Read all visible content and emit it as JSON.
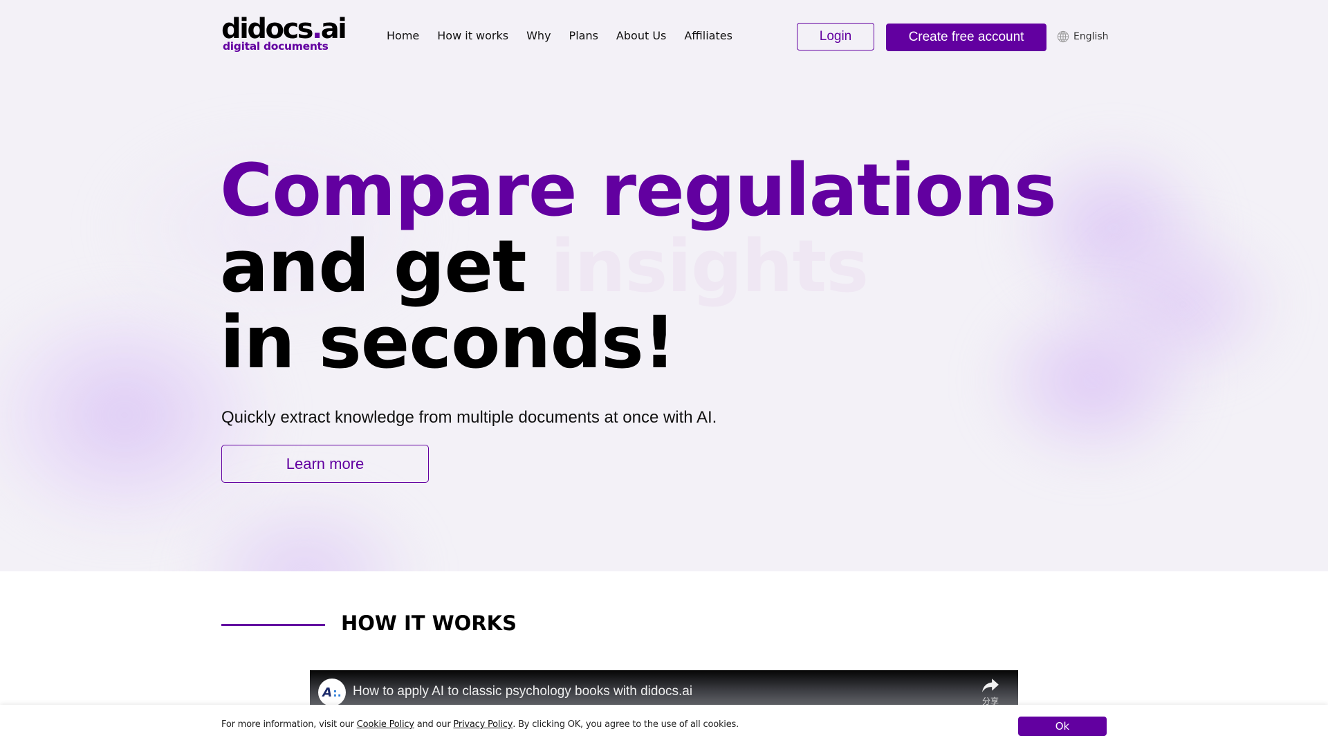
{
  "brand": {
    "logo_main": "didocs",
    "logo_dot": ".",
    "logo_tld": "ai",
    "logo_tagline": "digital documents",
    "accent_color": "#6200a0"
  },
  "nav": {
    "items": [
      {
        "label": "Home"
      },
      {
        "label": "How it works"
      },
      {
        "label": "Why"
      },
      {
        "label": "Plans"
      },
      {
        "label": "About Us"
      },
      {
        "label": "Affiliates"
      }
    ],
    "login_label": "Login",
    "create_account_label": "Create free account",
    "language": {
      "icon": "globe-icon",
      "selected": "English"
    }
  },
  "hero": {
    "title_line1": "Compare regulations",
    "title_line2": "and get",
    "title_line2_faded": "insights",
    "title_line3": "in seconds!",
    "subtitle": "Quickly extract knowledge from multiple documents at once with AI.",
    "cta_label": "Learn more"
  },
  "how_it_works": {
    "title": "HOW IT WORKS",
    "video": {
      "channel_avatar_text": "A",
      "channel_avatar_dots": ":.",
      "title": "How to apply AI to classic psychology books with didocs.ai",
      "share_icon": "share-icon",
      "share_label": "分享"
    }
  },
  "cookie_bar": {
    "text_before": "For more information, visit our ",
    "cookie_policy_link": "Cookie Policy",
    "text_middle": " and our ",
    "privacy_policy_link": "Privacy Policy",
    "text_after": ". By clicking OK, you agree to the use of all cookies.",
    "ok_label": "Ok"
  }
}
